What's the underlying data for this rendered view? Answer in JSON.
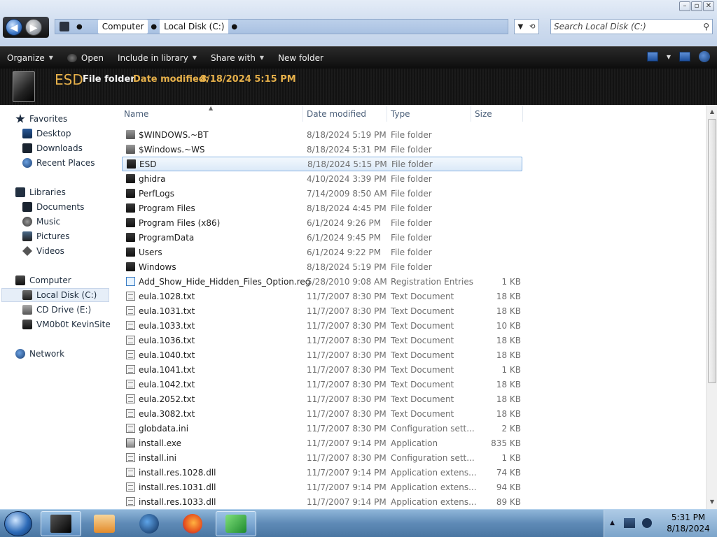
{
  "window": {
    "minimize": "–",
    "maximize": "▫",
    "close": "✕"
  },
  "address": {
    "crumbs": [
      "Computer",
      "Local Disk (C:)"
    ],
    "search_placeholder": "Search Local Disk (C:)"
  },
  "toolbar": {
    "organize": "Organize",
    "open": "Open",
    "include": "Include in library",
    "share": "Share with",
    "new_folder": "New folder"
  },
  "details": {
    "name": "ESD",
    "type": "File folder",
    "modified_label": "Date modified:",
    "modified_value": "8/18/2024 5:15 PM"
  },
  "nav": {
    "favorites": "Favorites",
    "desktop": "Desktop",
    "downloads": "Downloads",
    "recent": "Recent Places",
    "libraries": "Libraries",
    "documents": "Documents",
    "music": "Music",
    "pictures": "Pictures",
    "videos": "Videos",
    "computer": "Computer",
    "local_disk": "Local Disk (C:)",
    "cd_drive": "CD Drive (E:)",
    "share": "VM0b0t KevinSite",
    "network": "Network"
  },
  "columns": {
    "name": "Name",
    "date": "Date modified",
    "type": "Type",
    "size": "Size"
  },
  "files": [
    {
      "name": "$WINDOWS.~BT",
      "date": "8/18/2024 5:19 PM",
      "type": "File folder",
      "size": "",
      "icon": "folder-light"
    },
    {
      "name": "$Windows.~WS",
      "date": "8/18/2024 5:31 PM",
      "type": "File folder",
      "size": "",
      "icon": "folder-light"
    },
    {
      "name": "ESD",
      "date": "8/18/2024 5:15 PM",
      "type": "File folder",
      "size": "",
      "icon": "folder"
    },
    {
      "name": "ghidra",
      "date": "4/10/2024 3:39 PM",
      "type": "File folder",
      "size": "",
      "icon": "folder"
    },
    {
      "name": "PerfLogs",
      "date": "7/14/2009 8:50 AM",
      "type": "File folder",
      "size": "",
      "icon": "folder"
    },
    {
      "name": "Program Files",
      "date": "8/18/2024 4:45 PM",
      "type": "File folder",
      "size": "",
      "icon": "folder"
    },
    {
      "name": "Program Files (x86)",
      "date": "6/1/2024 9:26 PM",
      "type": "File folder",
      "size": "",
      "icon": "folder"
    },
    {
      "name": "ProgramData",
      "date": "6/1/2024 9:45 PM",
      "type": "File folder",
      "size": "",
      "icon": "folder"
    },
    {
      "name": "Users",
      "date": "6/1/2024 9:22 PM",
      "type": "File folder",
      "size": "",
      "icon": "folder"
    },
    {
      "name": "Windows",
      "date": "8/18/2024 5:19 PM",
      "type": "File folder",
      "size": "",
      "icon": "folder"
    },
    {
      "name": "Add_Show_Hide_Hidden_Files_Option.reg",
      "date": "5/28/2010 9:08 AM",
      "type": "Registration Entries",
      "size": "1 KB",
      "icon": "reg"
    },
    {
      "name": "eula.1028.txt",
      "date": "11/7/2007 8:30 PM",
      "type": "Text Document",
      "size": "18 KB",
      "icon": "doc"
    },
    {
      "name": "eula.1031.txt",
      "date": "11/7/2007 8:30 PM",
      "type": "Text Document",
      "size": "18 KB",
      "icon": "doc"
    },
    {
      "name": "eula.1033.txt",
      "date": "11/7/2007 8:30 PM",
      "type": "Text Document",
      "size": "10 KB",
      "icon": "doc"
    },
    {
      "name": "eula.1036.txt",
      "date": "11/7/2007 8:30 PM",
      "type": "Text Document",
      "size": "18 KB",
      "icon": "doc"
    },
    {
      "name": "eula.1040.txt",
      "date": "11/7/2007 8:30 PM",
      "type": "Text Document",
      "size": "18 KB",
      "icon": "doc"
    },
    {
      "name": "eula.1041.txt",
      "date": "11/7/2007 8:30 PM",
      "type": "Text Document",
      "size": "1 KB",
      "icon": "doc"
    },
    {
      "name": "eula.1042.txt",
      "date": "11/7/2007 8:30 PM",
      "type": "Text Document",
      "size": "18 KB",
      "icon": "doc"
    },
    {
      "name": "eula.2052.txt",
      "date": "11/7/2007 8:30 PM",
      "type": "Text Document",
      "size": "18 KB",
      "icon": "doc"
    },
    {
      "name": "eula.3082.txt",
      "date": "11/7/2007 8:30 PM",
      "type": "Text Document",
      "size": "18 KB",
      "icon": "doc"
    },
    {
      "name": "globdata.ini",
      "date": "11/7/2007 8:30 PM",
      "type": "Configuration sett...",
      "size": "2 KB",
      "icon": "doc"
    },
    {
      "name": "install.exe",
      "date": "11/7/2007 9:14 PM",
      "type": "Application",
      "size": "835 KB",
      "icon": "exe"
    },
    {
      "name": "install.ini",
      "date": "11/7/2007 8:30 PM",
      "type": "Configuration sett...",
      "size": "1 KB",
      "icon": "doc"
    },
    {
      "name": "install.res.1028.dll",
      "date": "11/7/2007 9:14 PM",
      "type": "Application extens...",
      "size": "74 KB",
      "icon": "doc"
    },
    {
      "name": "install.res.1031.dll",
      "date": "11/7/2007 9:14 PM",
      "type": "Application extens...",
      "size": "94 KB",
      "icon": "doc"
    },
    {
      "name": "install.res.1033.dll",
      "date": "11/7/2007 9:14 PM",
      "type": "Application extens...",
      "size": "89 KB",
      "icon": "doc"
    }
  ],
  "selected_file": "ESD",
  "taskbar": {
    "time": "5:31 PM",
    "date": "8/18/2024"
  }
}
